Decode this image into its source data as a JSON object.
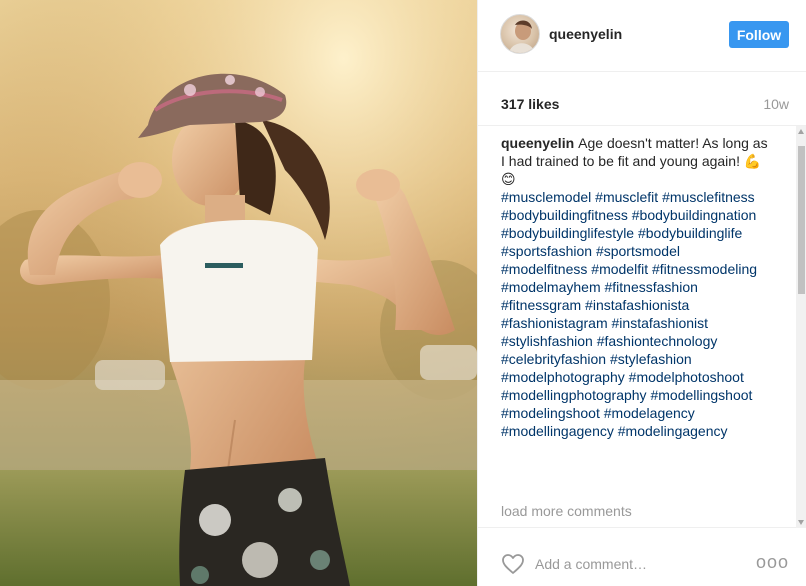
{
  "post": {
    "username": "queenyelin",
    "follow_label": "Follow",
    "likes": "317 likes",
    "age": "10w",
    "caption_text": "Age doesn't matter! As long as I had trained to be fit and young again! 💪😊",
    "hashtags": [
      "#musclemodel",
      "#musclefit",
      "#musclefitness",
      "#bodybuildingfitness",
      "#bodybuildingnation",
      "#bodybuildinglifestyle",
      "#bodybuildinglife",
      "#sportsfashion",
      "#sportsmodel",
      "#modelfitness",
      "#modelfit",
      "#fitnessmodeling",
      "#modelmayhem",
      "#fitnessfashion",
      "#fitnessgram",
      "#instafashionista",
      "#fashionistagram",
      "#instafashionist",
      "#stylishfashion",
      "#fashiontechnology",
      "#celebrityfashion",
      "#stylefashion",
      "#modelphotography",
      "#modelphotoshoot",
      "#modellingphotography",
      "#modellingshoot",
      "#modelingshoot",
      "#modelagency",
      "#modellingagency",
      "#modelingagency"
    ],
    "load_more": "load more comments",
    "comment_placeholder": "Add a comment…",
    "more_glyph": "ooo"
  },
  "icons": {
    "heart": "heart-icon",
    "more": "more-options-icon"
  },
  "colors": {
    "follow_button": "#3897f0",
    "hashtag": "#003569",
    "muted": "#999999"
  }
}
